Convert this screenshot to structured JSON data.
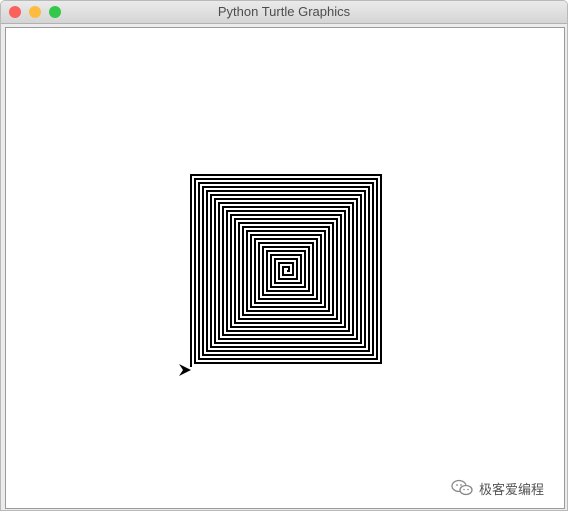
{
  "window": {
    "title": "Python Turtle Graphics",
    "buttons": {
      "close_color": "#fc605c",
      "minimize_color": "#fdbc40",
      "maximize_color": "#34c84a"
    }
  },
  "canvas": {
    "background": "#ffffff",
    "drawing": {
      "shape": "square-spiral",
      "pen_color": "#000000",
      "turtle_icon": "turtle-arrow-icon",
      "turtle_heading": "east"
    }
  },
  "watermark": {
    "icon": "wechat-icon",
    "text": "极客爱编程"
  }
}
